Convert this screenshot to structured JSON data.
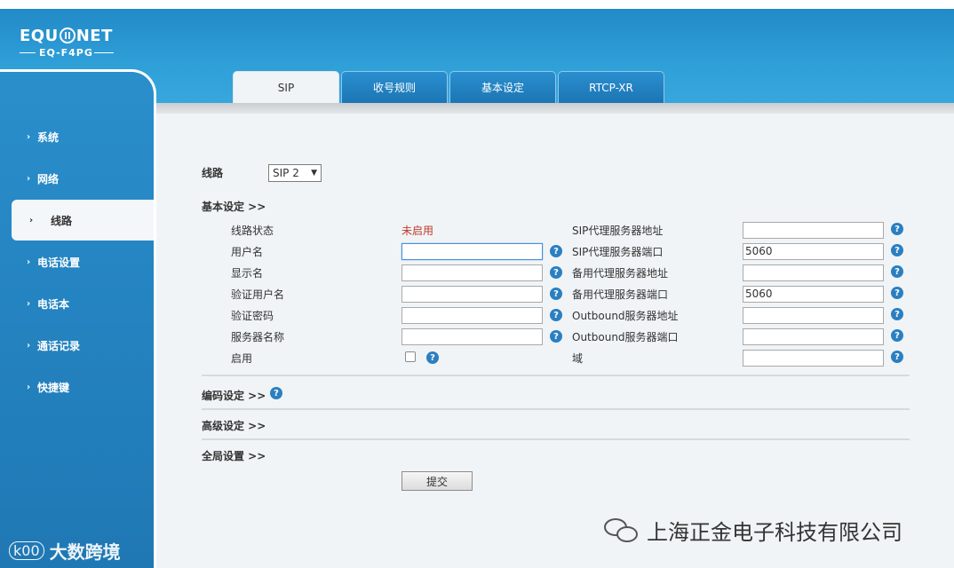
{
  "brand": {
    "name_left": "EQU",
    "name_right": "NET",
    "model": "EQ-F4PG"
  },
  "tabs": [
    {
      "label": "SIP",
      "active": true
    },
    {
      "label": "收号规则",
      "active": false
    },
    {
      "label": "基本设定",
      "active": false
    },
    {
      "label": "RTCP-XR",
      "active": false
    }
  ],
  "sidebar": {
    "items": [
      {
        "label": "系统"
      },
      {
        "label": "网络"
      },
      {
        "label": "线路"
      },
      {
        "label": "电话设置"
      },
      {
        "label": "电话本"
      },
      {
        "label": "通话记录"
      },
      {
        "label": "快捷键"
      }
    ],
    "active_index": 2
  },
  "line_select": {
    "label": "线路",
    "value": "SIP 2"
  },
  "sections": {
    "basic": "基本设定 >>",
    "codec": "编码设定 >>",
    "advanced": "高级设定 >>",
    "global": "全局设置 >>"
  },
  "form_left": {
    "line_status": {
      "label": "线路状态",
      "value": "未启用"
    },
    "username": {
      "label": "用户名",
      "value": ""
    },
    "display_name": {
      "label": "显示名",
      "value": ""
    },
    "auth_username": {
      "label": "验证用户名",
      "value": ""
    },
    "auth_password": {
      "label": "验证密码",
      "value": ""
    },
    "server_name": {
      "label": "服务器名称",
      "value": ""
    },
    "enable": {
      "label": "启用",
      "checked": false
    }
  },
  "form_right": {
    "sip_proxy_addr": {
      "label": "SIP代理服务器地址",
      "value": ""
    },
    "sip_proxy_port": {
      "label": "SIP代理服务器端口",
      "value": "5060"
    },
    "backup_proxy_addr": {
      "label": "备用代理服务器地址",
      "value": ""
    },
    "backup_proxy_port": {
      "label": "备用代理服务器端口",
      "value": "5060"
    },
    "outbound_addr": {
      "label": "Outbound服务器地址",
      "value": ""
    },
    "outbound_port": {
      "label": "Outbound服务器端口",
      "value": ""
    },
    "domain": {
      "label": "域",
      "value": ""
    }
  },
  "help_glyph": "?",
  "submit_label": "提交",
  "watermarks": {
    "left_logo": "k00",
    "left_text": "大数跨境",
    "right_text": "上海正金电子科技有限公司"
  },
  "colors": {
    "header_blue": "#2f9fd8",
    "help_blue": "#2b7fc1",
    "status_red": "#c0392b",
    "content_bg": "#f0f4f6"
  }
}
